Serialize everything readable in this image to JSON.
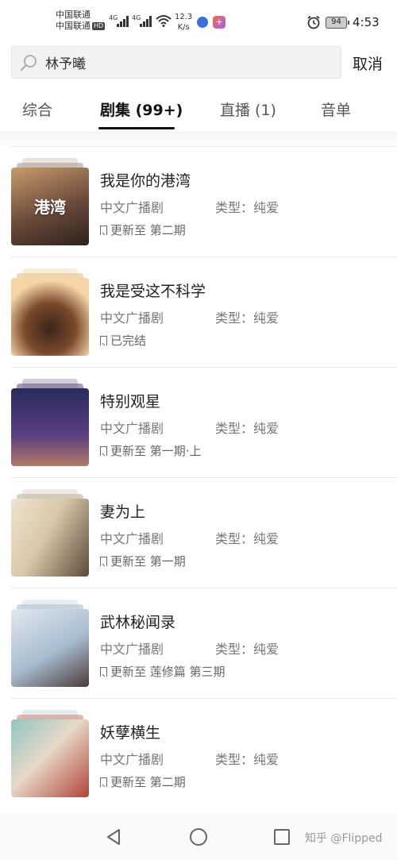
{
  "status_bar": {
    "carrier1": "中国联通",
    "carrier2": "中国联通",
    "hd": "HD",
    "sig1": "4G",
    "sig2": "4G",
    "speed_value": "12.3",
    "speed_unit": "K/s",
    "battery": "94",
    "time": "4:53"
  },
  "search": {
    "query": "林予曦",
    "cancel_label": "取消"
  },
  "tabs": [
    {
      "label": "综合",
      "active": false
    },
    {
      "label": "剧集 (99+)",
      "active": true
    },
    {
      "label": "直播 (1)",
      "active": false
    },
    {
      "label": "音单",
      "active": false
    }
  ],
  "items": [
    {
      "title": "我是你的港湾",
      "category": "中文广播剧",
      "genre": "类型：纯爱",
      "status": "更新至 第二期",
      "cover_text": "港湾",
      "cover_colors": [
        "#6b4a3a",
        "#c99b6d"
      ]
    },
    {
      "title": "我是受这不科学",
      "category": "中文广播剧",
      "genre": "类型：纯爱",
      "status": "已完结",
      "cover_text": "",
      "cover_colors": [
        "#f6d4a6",
        "#7a4a2c"
      ]
    },
    {
      "title": "特别观星",
      "category": "中文广播剧",
      "genre": "类型：纯爱",
      "status": "更新至 第一期·上",
      "cover_text": "",
      "cover_colors": [
        "#2a2a5e",
        "#6a4a8a"
      ]
    },
    {
      "title": "妻为上",
      "category": "中文广播剧",
      "genre": "类型：纯爱",
      "status": "更新至 第一期",
      "cover_text": "",
      "cover_colors": [
        "#efe4d0",
        "#b6a080"
      ]
    },
    {
      "title": "武林秘闻录",
      "category": "中文广播剧",
      "genre": "类型：纯爱",
      "status": "更新至 莲修篇 第三期",
      "cover_text": "",
      "cover_colors": [
        "#dfe8f0",
        "#7f98b4"
      ]
    },
    {
      "title": "妖孽横生",
      "category": "中文广播剧",
      "genre": "类型：纯爱",
      "status": "更新至 第二期",
      "cover_text": "",
      "cover_colors": [
        "#8fc6c2",
        "#b04438"
      ]
    }
  ],
  "watermark": "知乎 @Flipped"
}
